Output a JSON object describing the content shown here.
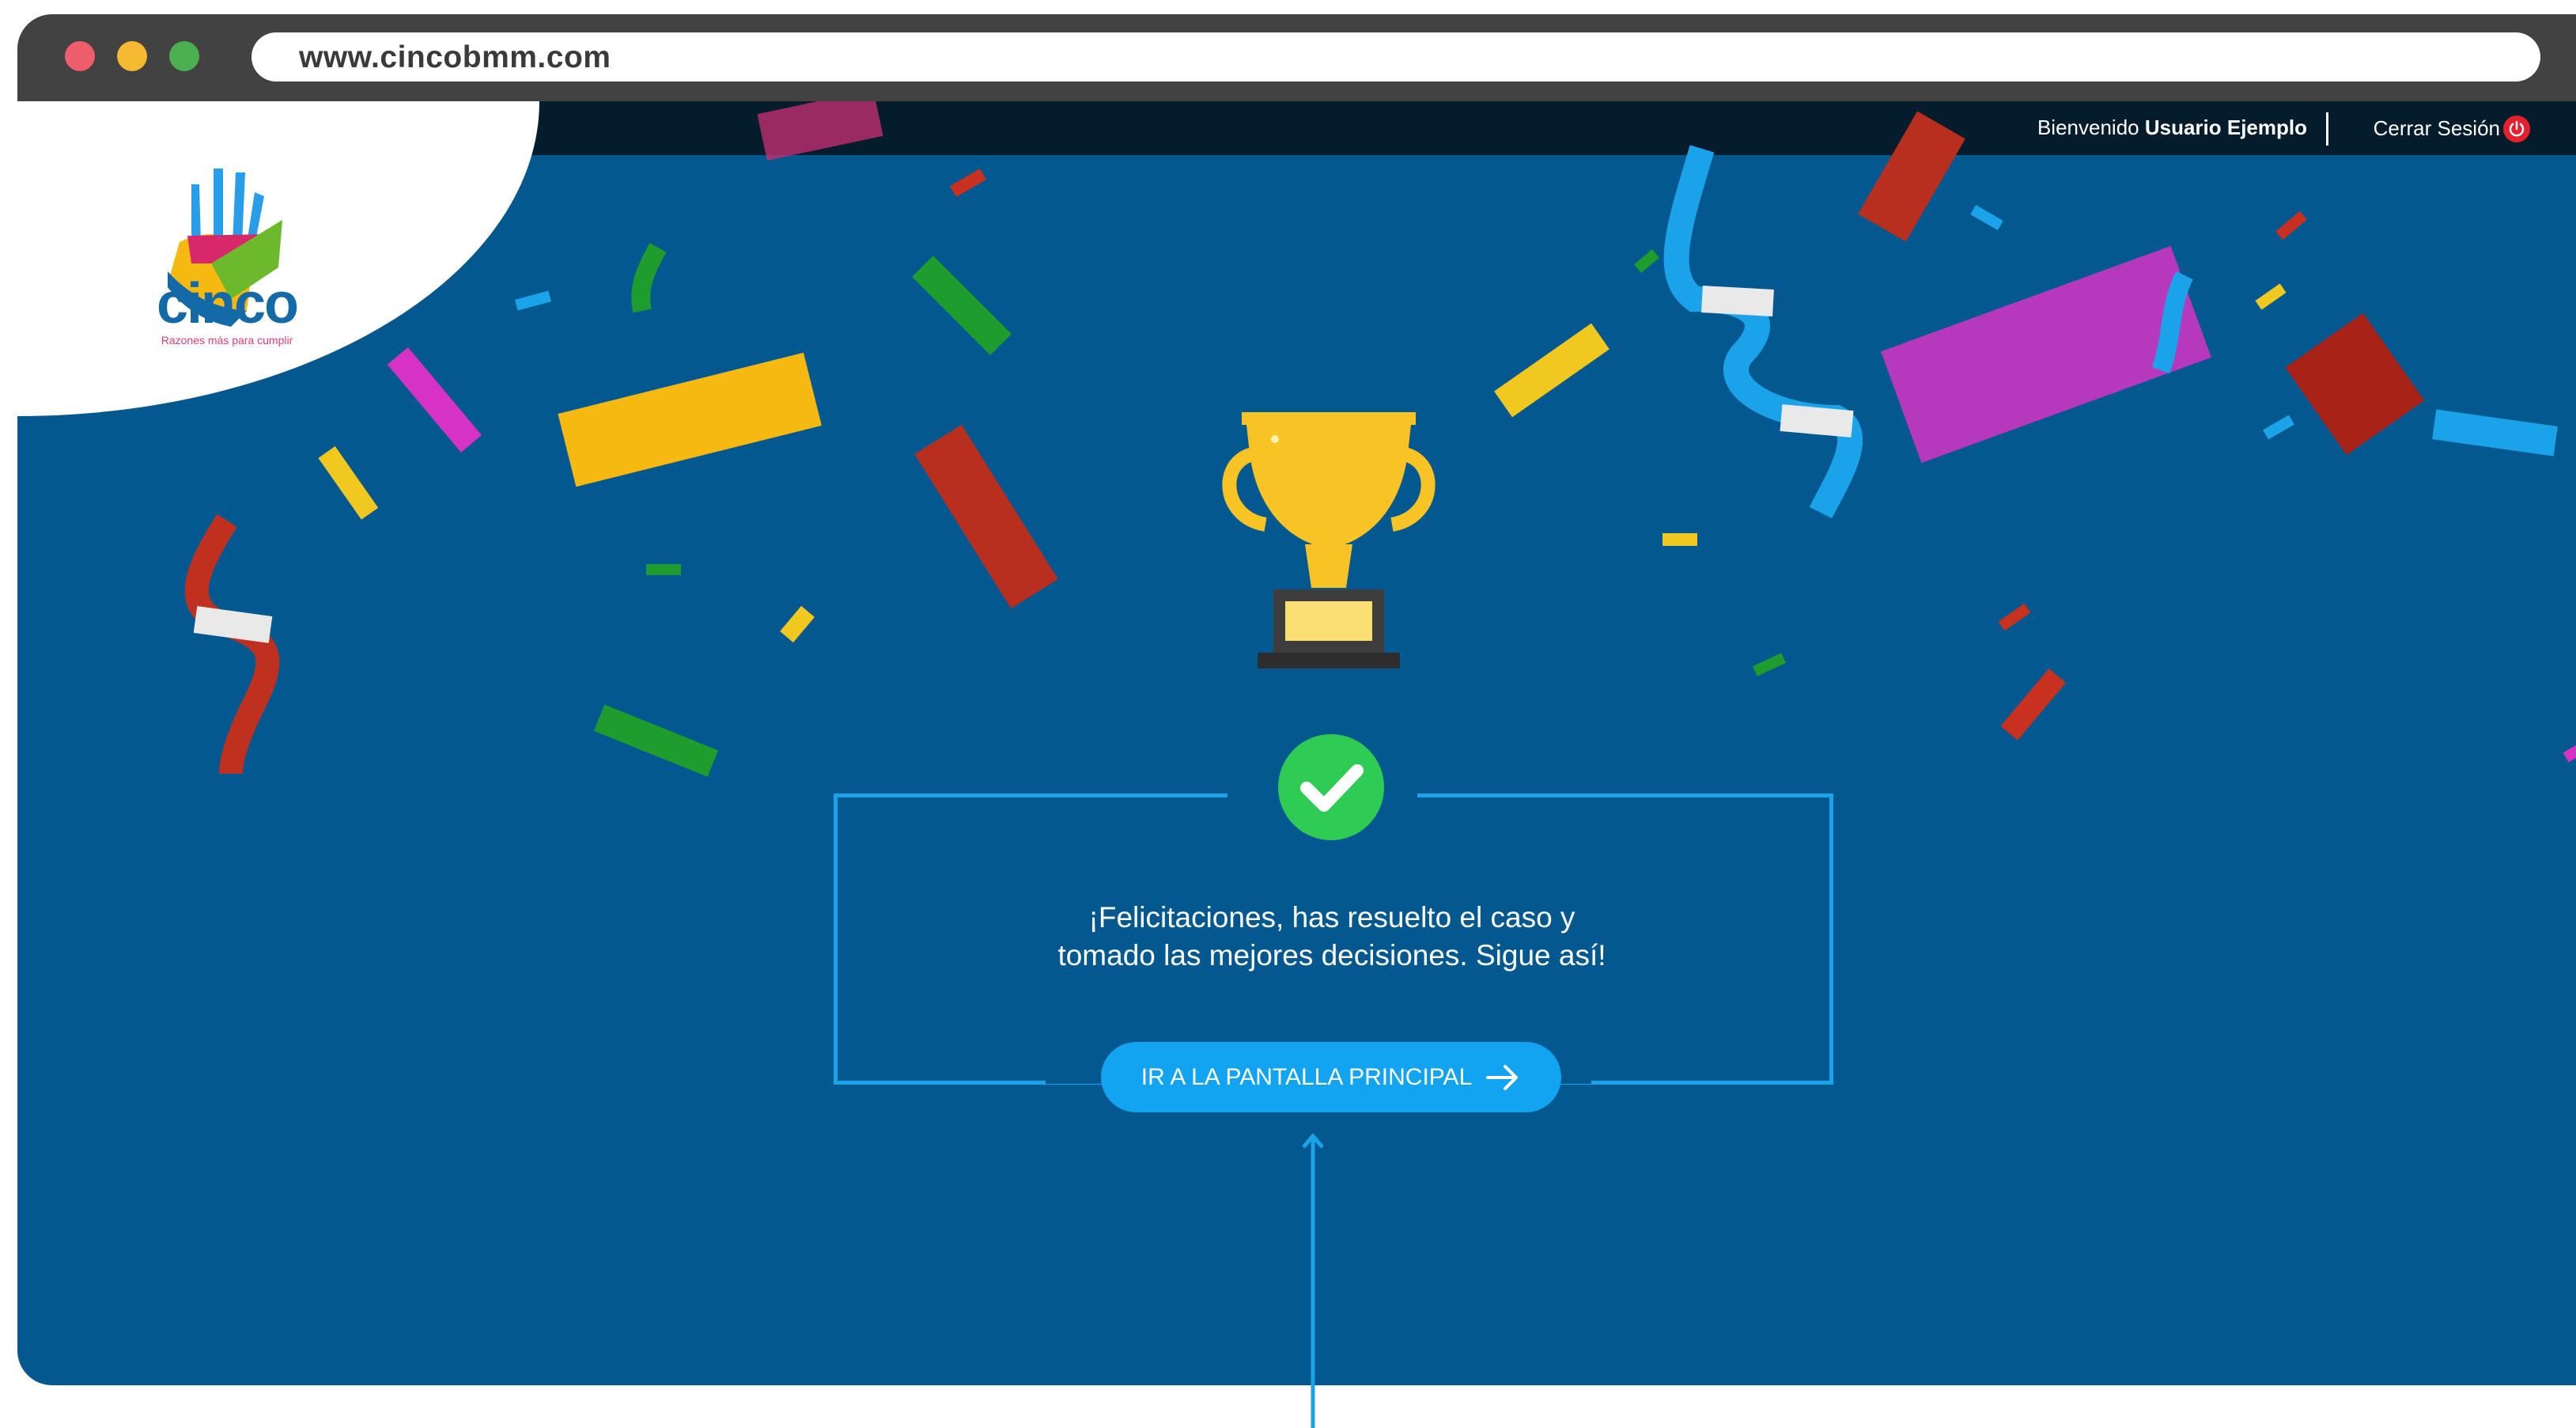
{
  "browser": {
    "url": "www.cincobmm.com"
  },
  "topbar": {
    "welcome_prefix": "Bienvenido ",
    "user_name": "Usuario Ejemplo",
    "logout_label": "Cerrar Sesión",
    "logout_icon": "power-icon"
  },
  "logo": {
    "name": "cinco",
    "tagline": "Razones más para cumplir",
    "icon": "hand-logo-icon"
  },
  "main": {
    "trophy_icon": "trophy-icon",
    "success_icon": "check-circle-icon",
    "message_line1": "¡Felicitaciones, has resuelto el caso y",
    "message_line2": "tomado las mejores decisiones. Sigue así!",
    "cta_label": "IR A LA PANTALLA PRINCIPAL",
    "cta_icon": "arrow-right-icon"
  },
  "colors": {
    "background": "#02588f",
    "topbar": "#041c2b",
    "accent": "#12a3f1",
    "success": "#2ecc55",
    "trophy": "#f7c325",
    "logout": "#e4202e"
  }
}
